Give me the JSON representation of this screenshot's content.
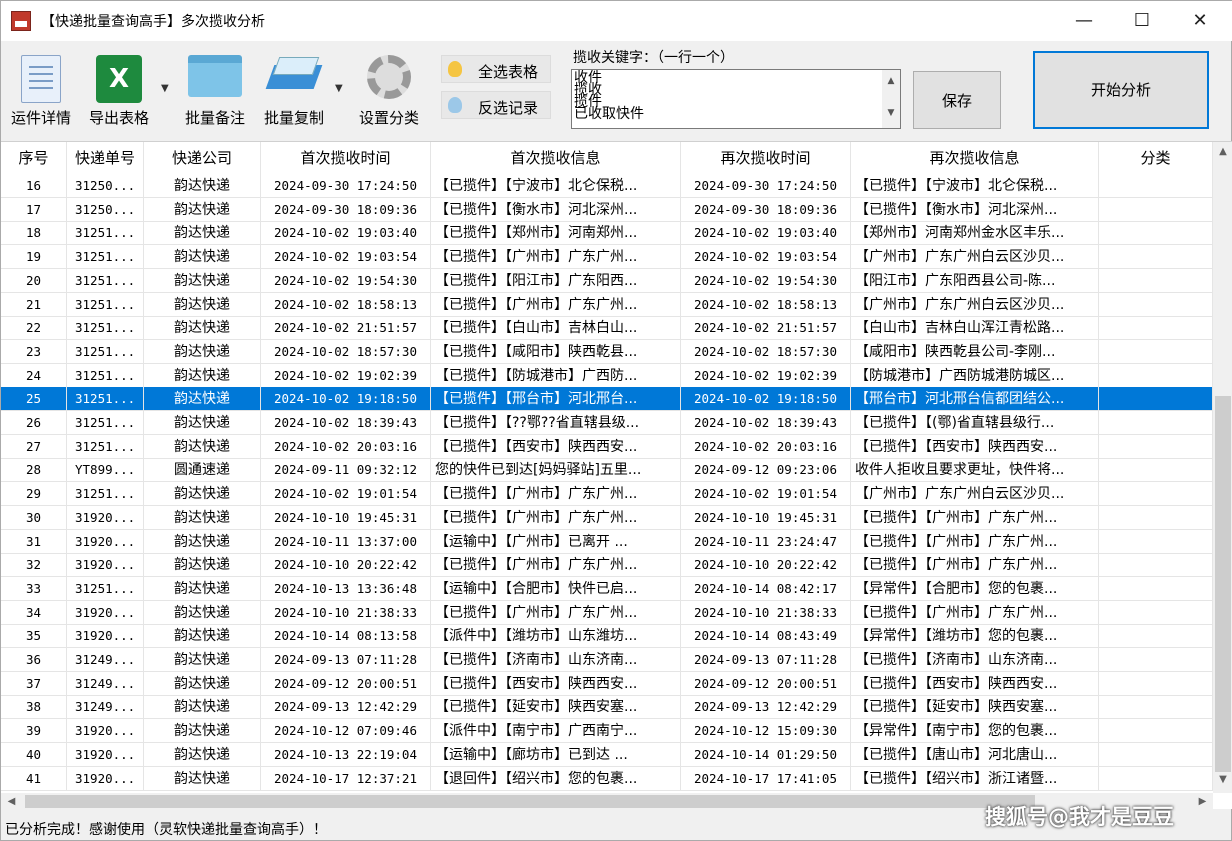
{
  "window": {
    "title": "【快递批量查询高手】多次揽收分析",
    "minimize_label": "—",
    "maximize_label": "☐",
    "close_label": "✕"
  },
  "toolbar": {
    "detail_label": "运件详情",
    "export_label": "导出表格",
    "export_icon_text": "X",
    "note_label": "批量备注",
    "copy_label": "批量复制",
    "category_label": "设置分类",
    "select_all_label": "全选表格",
    "invert_label": "反选记录",
    "dropdown_arrow": "▼"
  },
  "keywords": {
    "label": "揽收关键字：（一行一个）",
    "lines": [
      "收件",
      "揽收",
      "揽件",
      "已收取快件"
    ],
    "scroll_up": "▲",
    "scroll_down": "▼"
  },
  "buttons": {
    "save_label": "保存",
    "start_label": "开始分析"
  },
  "table": {
    "columns": [
      "序号",
      "快递单号",
      "快递公司",
      "首次揽收时间",
      "首次揽收信息",
      "再次揽收时间",
      "再次揽收信息",
      "分类"
    ],
    "selected_index": 9,
    "rows": [
      [
        "16",
        "31250...",
        "韵达快递",
        "2024-09-30 17:24:50",
        "【已揽件】【宁波市】北仑保税...",
        "2024-09-30 17:24:50",
        "【已揽件】【宁波市】北仑保税...",
        ""
      ],
      [
        "17",
        "31250...",
        "韵达快递",
        "2024-09-30 18:09:36",
        "【已揽件】【衡水市】河北深州...",
        "2024-09-30 18:09:36",
        "【已揽件】【衡水市】河北深州...",
        ""
      ],
      [
        "18",
        "31251...",
        "韵达快递",
        "2024-10-02 19:03:40",
        "【已揽件】【郑州市】河南郑州...",
        "2024-10-02 19:03:40",
        "【郑州市】河南郑州金水区丰乐...",
        ""
      ],
      [
        "19",
        "31251...",
        "韵达快递",
        "2024-10-02 19:03:54",
        "【已揽件】【广州市】广东广州...",
        "2024-10-02 19:03:54",
        "【广州市】广东广州白云区沙贝...",
        ""
      ],
      [
        "20",
        "31251...",
        "韵达快递",
        "2024-10-02 19:54:30",
        "【已揽件】【阳江市】广东阳西...",
        "2024-10-02 19:54:30",
        "【阳江市】广东阳西县公司-陈...",
        ""
      ],
      [
        "21",
        "31251...",
        "韵达快递",
        "2024-10-02 18:58:13",
        "【已揽件】【广州市】广东广州...",
        "2024-10-02 18:58:13",
        "【广州市】广东广州白云区沙贝...",
        ""
      ],
      [
        "22",
        "31251...",
        "韵达快递",
        "2024-10-02 21:51:57",
        "【已揽件】【白山市】吉林白山...",
        "2024-10-02 21:51:57",
        "【白山市】吉林白山浑江青松路...",
        ""
      ],
      [
        "23",
        "31251...",
        "韵达快递",
        "2024-10-02 18:57:30",
        "【已揽件】【咸阳市】陕西乾县...",
        "2024-10-02 18:57:30",
        "【咸阳市】陕西乾县公司-李刚...",
        ""
      ],
      [
        "24",
        "31251...",
        "韵达快递",
        "2024-10-02 19:02:39",
        "【已揽件】【防城港市】广西防...",
        "2024-10-02 19:02:39",
        "【防城港市】广西防城港防城区...",
        ""
      ],
      [
        "25",
        "31251...",
        "韵达快递",
        "2024-10-02 19:18:50",
        "【已揽件】【邢台市】河北邢台...",
        "2024-10-02 19:18:50",
        "【邢台市】河北邢台信都团结公...",
        ""
      ],
      [
        "26",
        "31251...",
        "韵达快递",
        "2024-10-02 18:39:43",
        "【已揽件】【??鄂??省直辖县级...",
        "2024-10-02 18:39:43",
        "【已揽件】【(鄂)省直辖县级行...",
        ""
      ],
      [
        "27",
        "31251...",
        "韵达快递",
        "2024-10-02 20:03:16",
        "【已揽件】【西安市】陕西西安...",
        "2024-10-02 20:03:16",
        "【已揽件】【西安市】陕西西安...",
        ""
      ],
      [
        "28",
        "YT899...",
        "圆通速递",
        "2024-09-11 09:32:12",
        "您的快件已到达[妈妈驿站]五里...",
        "2024-09-12 09:23:06",
        "收件人拒收且要求更址，快件将...",
        ""
      ],
      [
        "29",
        "31251...",
        "韵达快递",
        "2024-10-02 19:01:54",
        "【已揽件】【广州市】广东广州...",
        "2024-10-02 19:01:54",
        "【广州市】广东广州白云区沙贝...",
        ""
      ],
      [
        "30",
        "31920...",
        "韵达快递",
        "2024-10-10 19:45:31",
        "【已揽件】【广州市】广东广州...",
        "2024-10-10 19:45:31",
        "【已揽件】【广州市】广东广州...",
        ""
      ],
      [
        "31",
        "31920...",
        "韵达快递",
        "2024-10-11 13:37:00",
        "【运输中】【广州市】已离开 ...",
        "2024-10-11 23:24:47",
        "【已揽件】【广州市】广东广州...",
        ""
      ],
      [
        "32",
        "31920...",
        "韵达快递",
        "2024-10-10 20:22:42",
        "【已揽件】【广州市】广东广州...",
        "2024-10-10 20:22:42",
        "【已揽件】【广州市】广东广州...",
        ""
      ],
      [
        "33",
        "31251...",
        "韵达快递",
        "2024-10-13 13:36:48",
        "【运输中】【合肥市】快件已启...",
        "2024-10-14 08:42:17",
        "【异常件】【合肥市】您的包裹...",
        ""
      ],
      [
        "34",
        "31920...",
        "韵达快递",
        "2024-10-10 21:38:33",
        "【已揽件】【广州市】广东广州...",
        "2024-10-10 21:38:33",
        "【已揽件】【广州市】广东广州...",
        ""
      ],
      [
        "35",
        "31920...",
        "韵达快递",
        "2024-10-14 08:13:58",
        "【派件中】【潍坊市】山东潍坊...",
        "2024-10-14 08:43:49",
        "【异常件】【潍坊市】您的包裹...",
        ""
      ],
      [
        "36",
        "31249...",
        "韵达快递",
        "2024-09-13 07:11:28",
        "【已揽件】【济南市】山东济南...",
        "2024-09-13 07:11:28",
        "【已揽件】【济南市】山东济南...",
        ""
      ],
      [
        "37",
        "31249...",
        "韵达快递",
        "2024-09-12 20:00:51",
        "【已揽件】【西安市】陕西西安...",
        "2024-09-12 20:00:51",
        "【已揽件】【西安市】陕西西安...",
        ""
      ],
      [
        "38",
        "31249...",
        "韵达快递",
        "2024-09-13 12:42:29",
        "【已揽件】【延安市】陕西安塞...",
        "2024-09-13 12:42:29",
        "【已揽件】【延安市】陕西安塞...",
        ""
      ],
      [
        "39",
        "31920...",
        "韵达快递",
        "2024-10-12 07:09:46",
        "【派件中】【南宁市】广西南宁...",
        "2024-10-12 15:09:30",
        "【异常件】【南宁市】您的包裹...",
        ""
      ],
      [
        "40",
        "31920...",
        "韵达快递",
        "2024-10-13 22:19:04",
        "【运输中】【廊坊市】已到达 ...",
        "2024-10-14 01:29:50",
        "【已揽件】【唐山市】河北唐山...",
        ""
      ],
      [
        "41",
        "31920...",
        "韵达快递",
        "2024-10-17 12:37:21",
        "【退回件】【绍兴市】您的包裹...",
        "2024-10-17 17:41:05",
        "【已揽件】【绍兴市】浙江诸暨...",
        ""
      ]
    ]
  },
  "scrollbars": {
    "up": "▲",
    "down": "▼",
    "left": "◀",
    "right": "▶"
  },
  "status_text": "已分析完成！感谢使用（灵软快递批量查询高手）！",
  "watermark": "搜狐号@我才是豆豆",
  "colors": {
    "selection": "#0078d7",
    "start_button_border": "#0078d7"
  }
}
